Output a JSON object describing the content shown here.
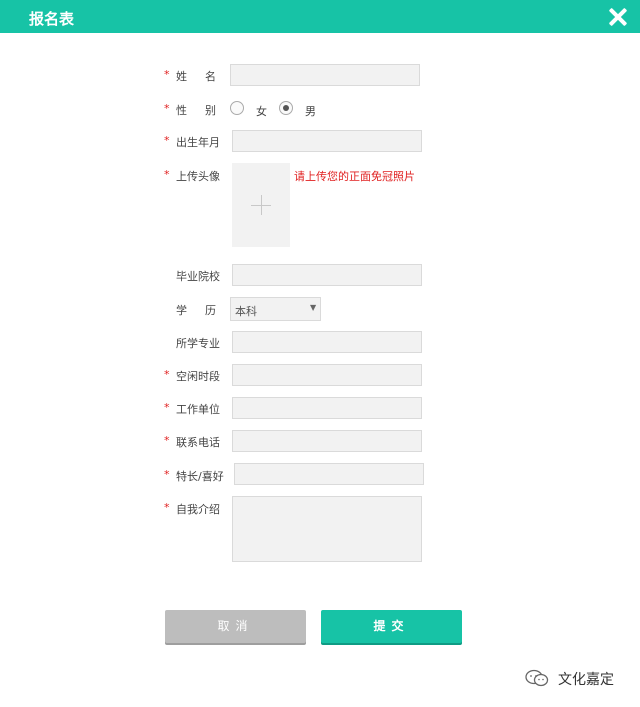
{
  "header": {
    "title": "报名表",
    "close_icon": "close-icon"
  },
  "form": {
    "required_mark": "*",
    "name_label": "姓名",
    "gender_label": "性别",
    "gender_options": [
      "女",
      "男"
    ],
    "gender_selected": "男",
    "birth_label": "出生年月",
    "avatar_label": "上传头像",
    "avatar_hint": "请上传您的正面免冠照片",
    "school_label": "毕业院校",
    "education_label": "学历",
    "education_value": "本科",
    "major_label": "所学专业",
    "free_time_label": "空闲时段",
    "work_unit_label": "工作单位",
    "phone_label": "联系电话",
    "hobby_label": "特长/喜好",
    "intro_label": "自我介绍"
  },
  "buttons": {
    "cancel_label": "取消",
    "submit_label": "提交"
  },
  "brand": {
    "name": "文化嘉定",
    "icon": "wechat-logo-icon"
  },
  "colors": {
    "accent": "#17c3a6",
    "required": "#e02020",
    "cancel": "#bdbdbd"
  }
}
